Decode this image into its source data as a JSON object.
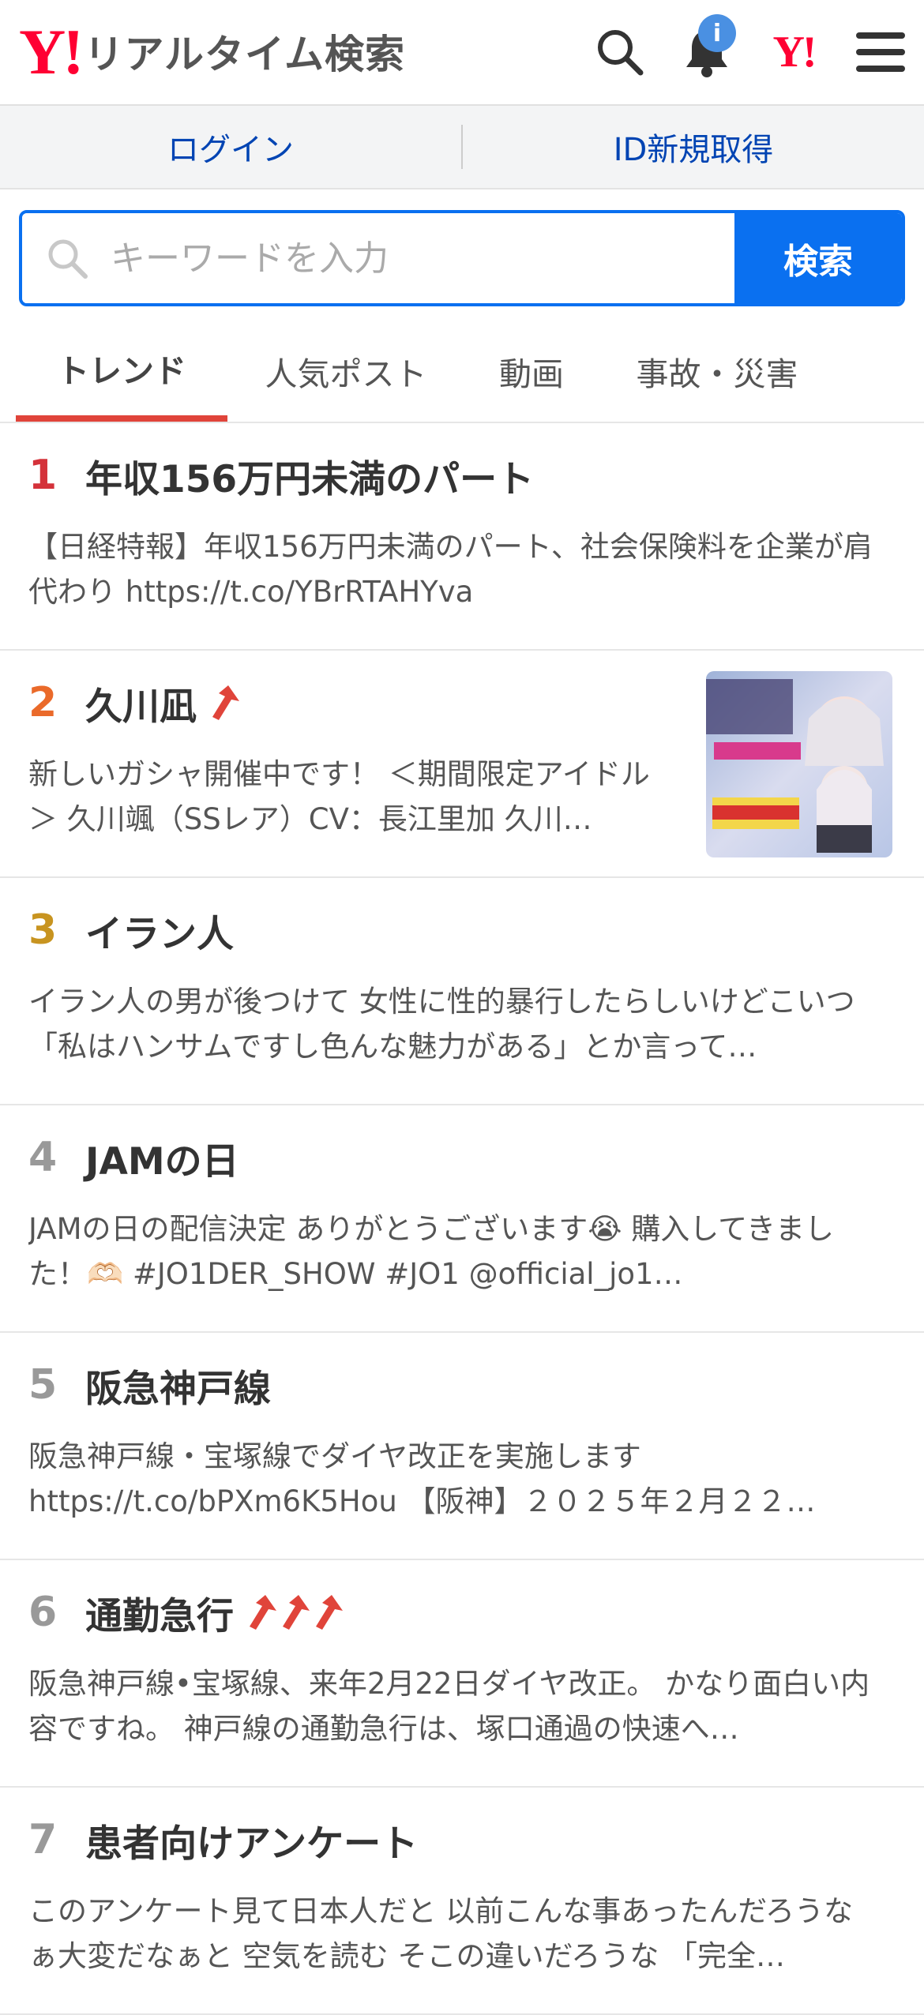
{
  "header": {
    "logo_mark": "Y!",
    "logo_text": "リアルタイム検索",
    "notification_badge": "i",
    "yj_mark": "Y!"
  },
  "account": {
    "login": "ログイン",
    "register": "ID新規取得"
  },
  "search": {
    "placeholder": "キーワードを入力",
    "button": "検索"
  },
  "tabs": [
    {
      "label": "トレンド",
      "active": true
    },
    {
      "label": "人気ポスト"
    },
    {
      "label": "動画"
    },
    {
      "label": "事故・災害"
    }
  ],
  "trends": [
    {
      "rank": "1",
      "title": "年収156万円未満のパート",
      "rising": 0,
      "desc": "【日経特報】年収156万円未満のパート、社会保険料を企業が肩代わり https://t.co/YBrRTAHYva"
    },
    {
      "rank": "2",
      "title": "久川凪",
      "rising": 1,
      "has_thumb": true,
      "desc": "新しいガシャ開催中です！ ＜期間限定アイドル＞ 久川颯（SSレア）CV：長江里加 久川…"
    },
    {
      "rank": "3",
      "title": "イラン人",
      "rising": 0,
      "desc": "イラン人の男が後つけて 女性に性的暴行したらしいけどこいつ「私はハンサムですし色んな魅力がある」とか言って…"
    },
    {
      "rank": "4",
      "title": "JAMの日",
      "rising": 0,
      "desc": "JAMの日の配信決定 ありがとうございます😭 購入してきました！🫶🏻 #JO1DER_SHOW #JO1 @official_jo1…"
    },
    {
      "rank": "5",
      "title": "阪急神戸線",
      "rising": 0,
      "desc": "阪急神戸線・宝塚線でダイヤ改正を実施します https://t.co/bPXm6K5Hou 【阪神】２０２５年２月２２…"
    },
    {
      "rank": "6",
      "title": "通勤急行",
      "rising": 3,
      "desc": "阪急神戸線•宝塚線、来年2月22日ダイヤ改正。 かなり面白い内容ですね。 神戸線の通勤急行は、塚口通過の快速へ…"
    },
    {
      "rank": "7",
      "title": "患者向けアンケート",
      "rising": 0,
      "desc": "このアンケート見て日本人だと 以前こんな事あったんだろうなぁ大変だなぁと 空気を読む そこの違いだろうな 「完全…"
    }
  ],
  "colors": {
    "brand_red": "#ff0033",
    "link_blue": "#0044b3",
    "search_blue": "#0a70f0",
    "tab_underline": "#e0443a"
  }
}
